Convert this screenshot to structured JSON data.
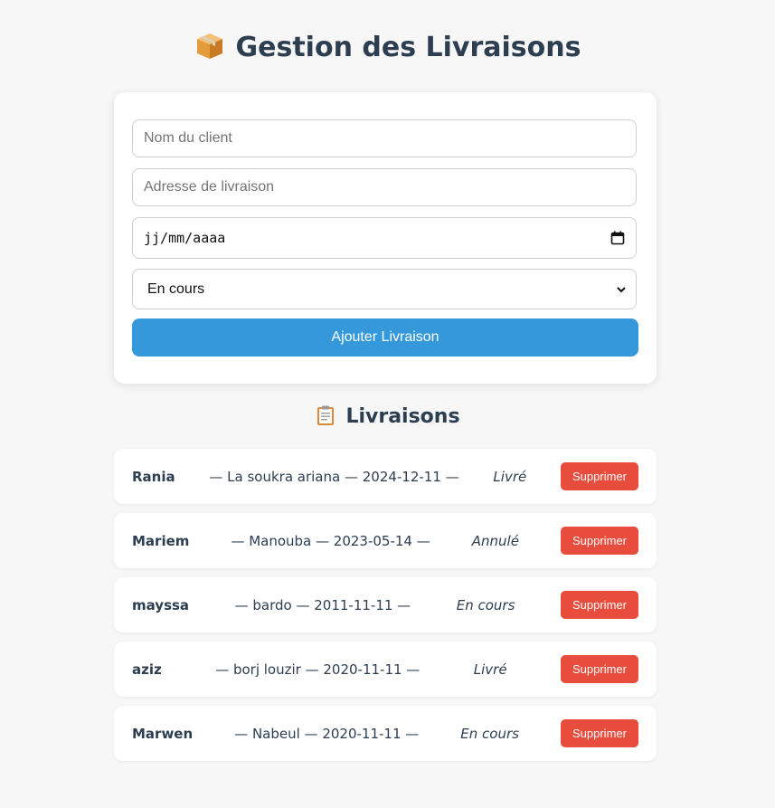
{
  "header": {
    "title": "Gestion des Livraisons",
    "icon": "package-icon"
  },
  "form": {
    "client_placeholder": "Nom du client",
    "address_placeholder": "Adresse de livraison",
    "date_placeholder": "jj/mm/aaaa",
    "status_selected": "En cours",
    "submit_label": "Ajouter Livraison",
    "accent_color": "#3498db"
  },
  "list": {
    "title": "Livraisons",
    "icon": "clipboard-icon",
    "delete_color": "#e74c3c",
    "items": [
      {
        "name": "Rania",
        "details": "— La soukra ariana — 2024-12-11 —",
        "status": "Livré",
        "delete_label": "Supprimer"
      },
      {
        "name": "Mariem",
        "details": "— Manouba — 2023-05-14 —",
        "status": "Annulé",
        "delete_label": "Supprimer"
      },
      {
        "name": "mayssa",
        "details": "— bardo — 2011-11-11 —",
        "status": "En cours",
        "delete_label": "Supprimer"
      },
      {
        "name": "aziz",
        "details": "— borj louzir — 2020-11-11 —",
        "status": "Livré",
        "delete_label": "Supprimer"
      },
      {
        "name": "Marwen",
        "details": "— Nabeul — 2020-11-11 —",
        "status": "En cours",
        "delete_label": "Supprimer"
      }
    ]
  }
}
